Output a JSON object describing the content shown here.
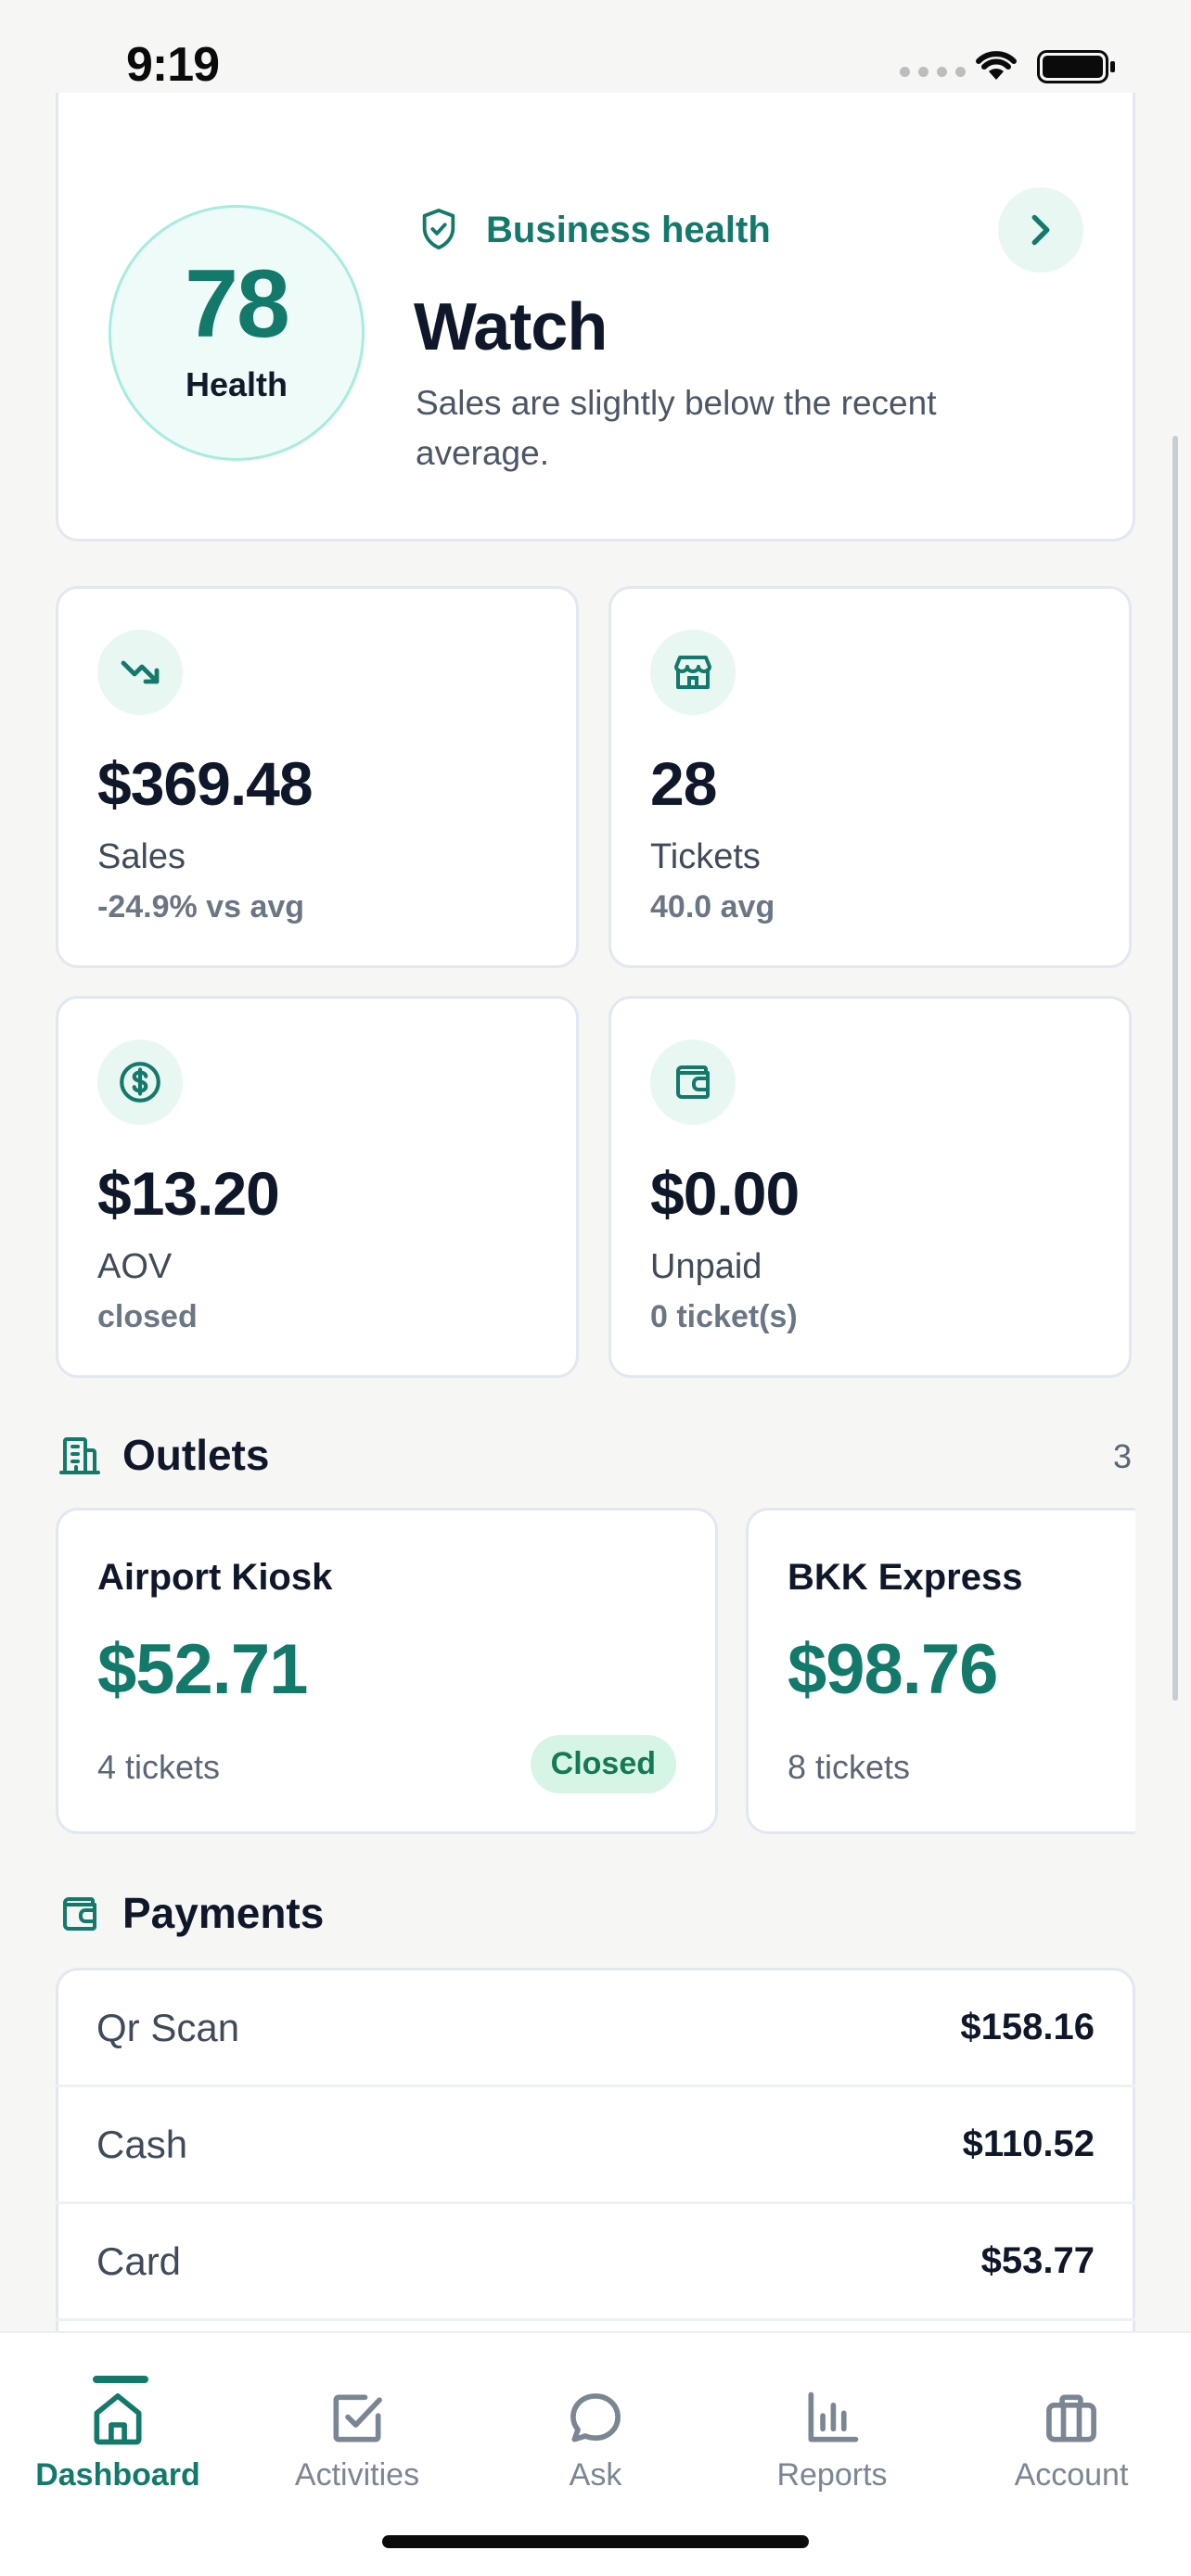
{
  "status_bar": {
    "time": "9:19"
  },
  "health": {
    "score": "78",
    "score_label": "Health",
    "title": "Business health",
    "status": "Watch",
    "description": "Sales are slightly below the recent average."
  },
  "metrics": [
    {
      "icon": "trending-down-icon",
      "value": "$369.48",
      "label": "Sales",
      "sub": "-24.9% vs avg"
    },
    {
      "icon": "store-icon",
      "value": "28",
      "label": "Tickets",
      "sub": "40.0 avg"
    },
    {
      "icon": "dollar-circle-icon",
      "value": "$13.20",
      "label": "AOV",
      "sub": "closed"
    },
    {
      "icon": "wallet-icon",
      "value": "$0.00",
      "label": "Unpaid",
      "sub": "0 ticket(s)"
    }
  ],
  "outlets": {
    "title": "Outlets",
    "count": "3",
    "items": [
      {
        "name": "Airport Kiosk",
        "sales": "$52.71",
        "tickets": "4 tickets",
        "status": "Closed"
      },
      {
        "name": "BKK Express",
        "sales": "$98.76",
        "tickets": "8 tickets"
      }
    ]
  },
  "payments": {
    "title": "Payments",
    "items": [
      {
        "method": "Qr Scan",
        "amount": "$158.16"
      },
      {
        "method": "Cash",
        "amount": "$110.52"
      },
      {
        "method": "Card",
        "amount": "$53.77"
      }
    ]
  },
  "tabs": [
    {
      "label": "Dashboard",
      "icon": "home-icon",
      "active": true
    },
    {
      "label": "Activities",
      "icon": "checkbox-icon"
    },
    {
      "label": "Ask",
      "icon": "chat-bubble-icon"
    },
    {
      "label": "Reports",
      "icon": "bar-chart-icon"
    },
    {
      "label": "Account",
      "icon": "briefcase-icon"
    }
  ],
  "colors": {
    "accent": "#137a6b",
    "accent_soft": "#e8f7f2",
    "text": "#0f172a",
    "muted": "#6b7685",
    "border": "#e2e8ef"
  }
}
